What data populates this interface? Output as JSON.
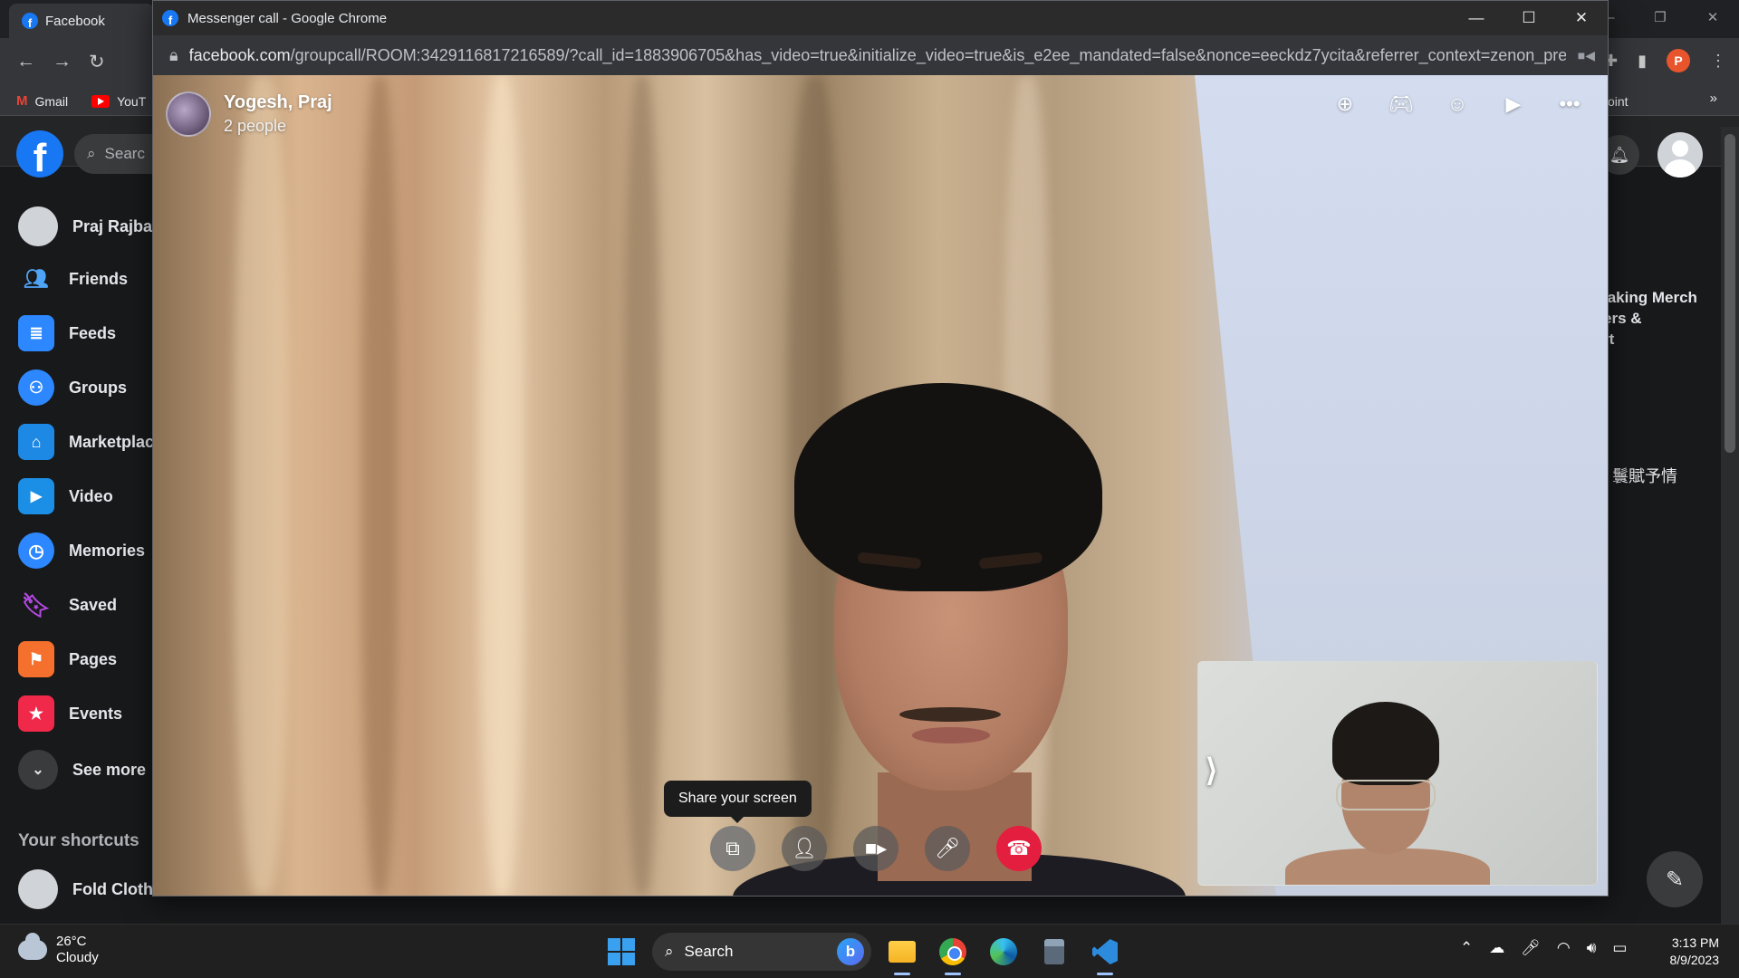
{
  "background_browser": {
    "tab_title": "Facebook",
    "bookmarks": [
      {
        "label": "Gmail"
      },
      {
        "label": "YouT"
      }
    ],
    "bookmark_partial_right": "oint",
    "bookmark_more": "»",
    "profile_letter": "P"
  },
  "facebook": {
    "search_placeholder": "Searc",
    "sidebar": [
      {
        "label": "Praj Rajban",
        "icon": "avatar"
      },
      {
        "label": "Friends",
        "icon": "friends-icon"
      },
      {
        "label": "Feeds",
        "icon": "feeds-icon"
      },
      {
        "label": "Groups",
        "icon": "groups-icon"
      },
      {
        "label": "Marketplac",
        "icon": "marketplace-icon"
      },
      {
        "label": "Video",
        "icon": "video-icon"
      },
      {
        "label": "Memories",
        "icon": "memories-icon"
      },
      {
        "label": "Saved",
        "icon": "saved-icon"
      },
      {
        "label": "Pages",
        "icon": "pages-icon"
      },
      {
        "label": "Events",
        "icon": "events-icon"
      },
      {
        "label": "See more",
        "icon": "chevron-down-icon"
      }
    ],
    "shortcuts_title": "Your shortcuts",
    "shortcut_first": "Fold Clothi",
    "right_partial_text": "laking Merch\ners &\nrt",
    "right_chinese_text": "鬟賦予情"
  },
  "popup": {
    "window_title": "Messenger call - Google Chrome",
    "url_domain": "facebook.com",
    "url_path": "/groupcall/ROOM:3429116817216589/?call_id=1883906705&has_video=true&initialize_video=true&is_e2ee_mandated=false&nonce=eeckdz7ycita&referrer_context=zenon_precall...",
    "call": {
      "names": "Yogesh, Praj",
      "people_count": "2 people",
      "tooltip": "Share your screen",
      "active_control": "share-screen"
    }
  },
  "taskbar": {
    "weather_temp": "26°C",
    "weather_desc": "Cloudy",
    "search_label": "Search",
    "time": "3:13 PM",
    "date": "8/9/2023"
  },
  "colors": {
    "facebook_blue": "#1877f2",
    "end_call_red": "#e41e3f",
    "windows_accent": "#3aa0f0"
  }
}
